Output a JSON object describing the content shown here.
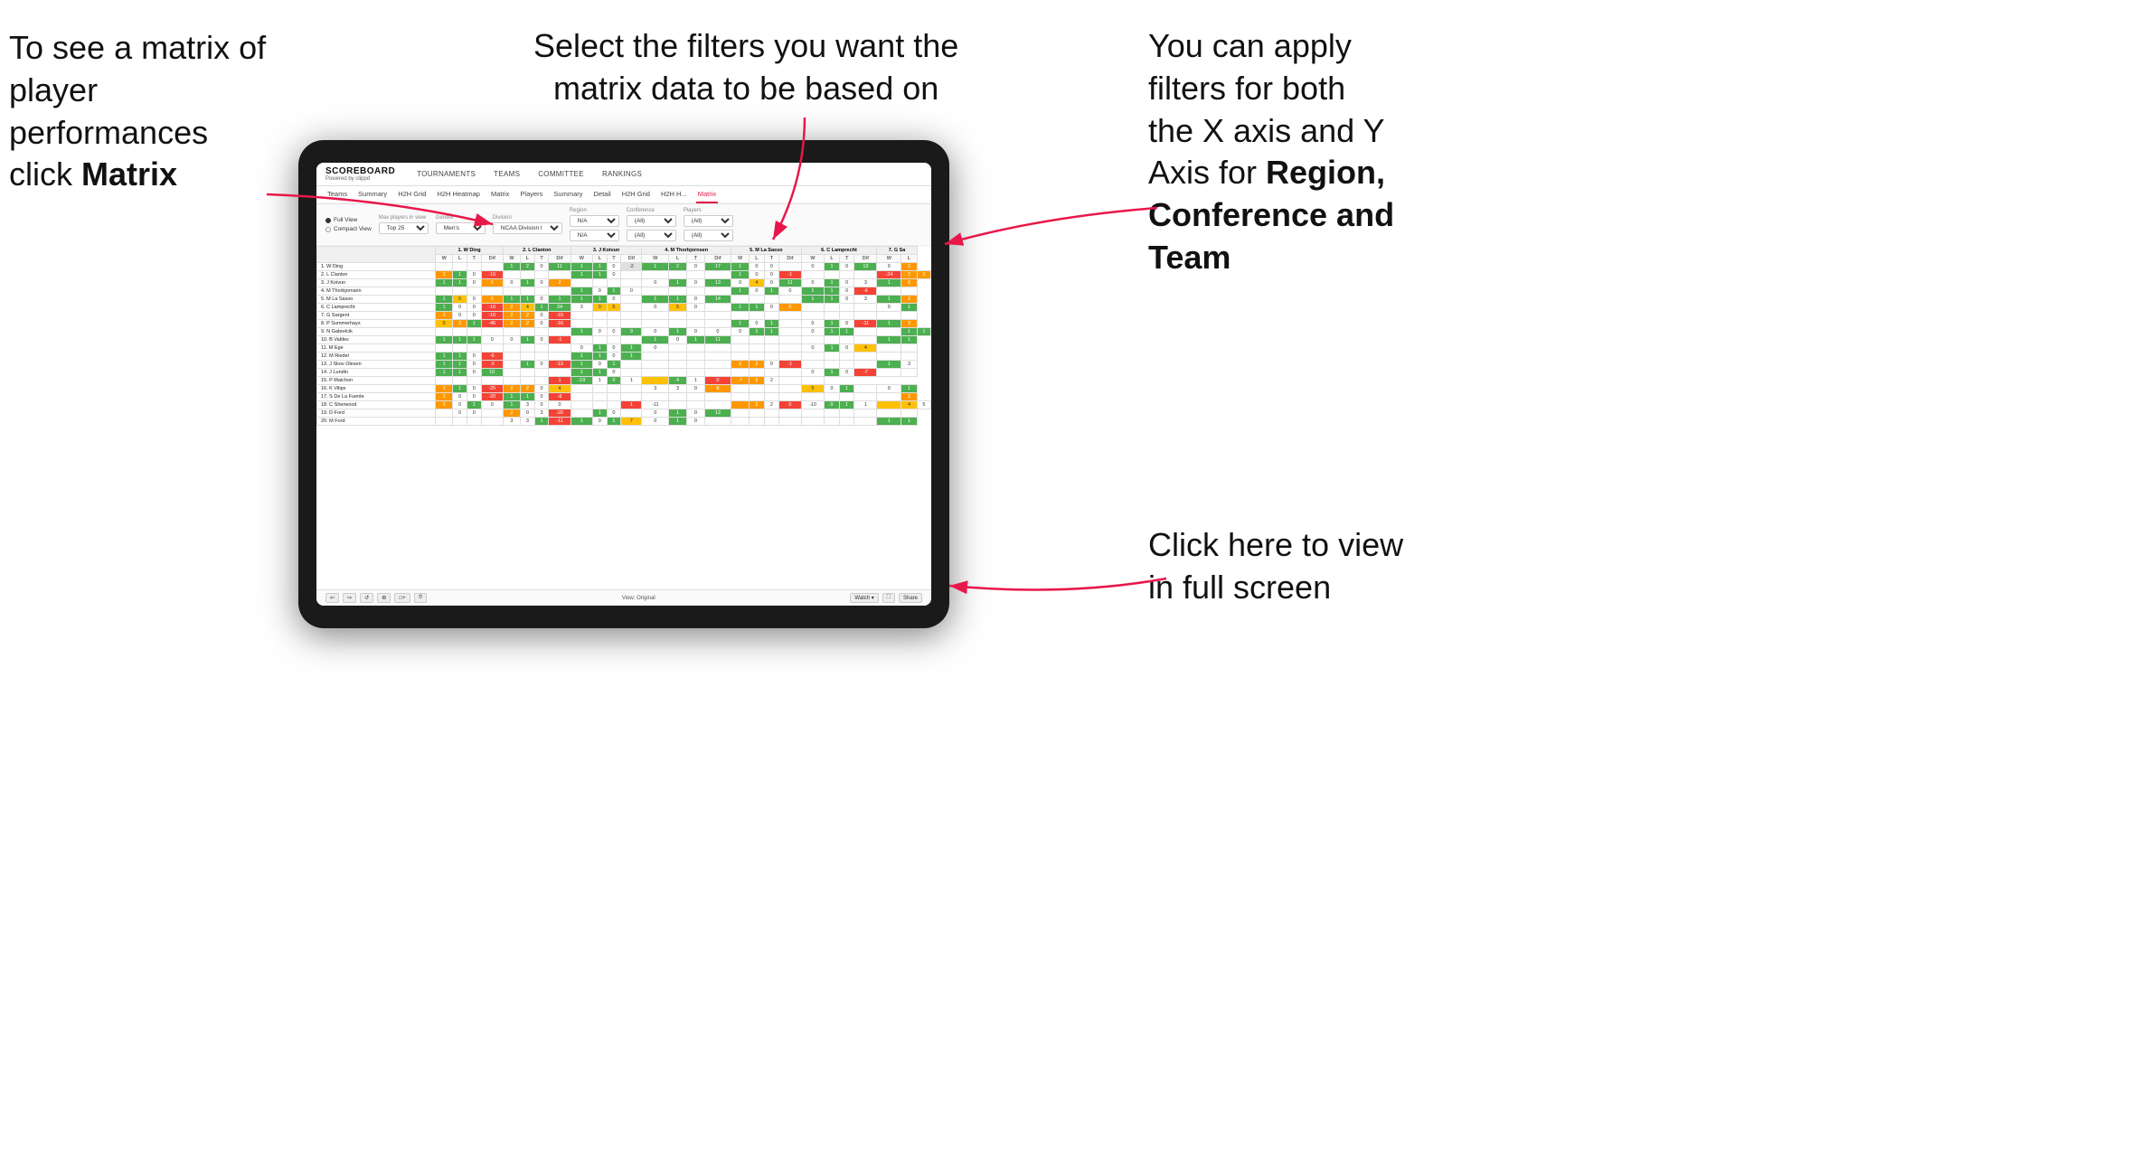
{
  "annotations": {
    "top_left": {
      "line1": "To see a matrix of",
      "line2": "player performances",
      "line3_normal": "click ",
      "line3_bold": "Matrix"
    },
    "top_center": {
      "line1": "Select the filters you want the",
      "line2": "matrix data to be based on"
    },
    "top_right": {
      "line1": "You  can apply",
      "line2": "filters for both",
      "line3": "the X axis and Y",
      "line4_normal": "Axis for ",
      "line4_bold": "Region,",
      "line5_bold": "Conference and",
      "line6_bold": "Team"
    },
    "bottom_right": {
      "line1": "Click here to view",
      "line2": "in full screen"
    }
  },
  "nav": {
    "logo_main": "SCOREBOARD",
    "logo_sub": "Powered by clippd",
    "items": [
      "TOURNAMENTS",
      "TEAMS",
      "COMMITTEE",
      "RANKINGS"
    ]
  },
  "sub_tabs": {
    "players_group": [
      "Teams",
      "Summary",
      "H2H Grid",
      "H2H Heatmap",
      "Matrix",
      "Players",
      "Summary",
      "Detail",
      "H2H Grid",
      "H2H H...",
      "Matrix"
    ],
    "active": "Matrix"
  },
  "filters": {
    "view_options": [
      "Full View",
      "Compact View"
    ],
    "active_view": "Full View",
    "max_players": {
      "label": "Max players in view",
      "value": "Top 25"
    },
    "gender": {
      "label": "Gender",
      "value": "Men's"
    },
    "division": {
      "label": "Division",
      "value": "NCAA Division I"
    },
    "region": {
      "label": "Region",
      "value1": "N/A",
      "value2": "N/A"
    },
    "conference": {
      "label": "Conference",
      "value1": "(All)",
      "value2": "(All)"
    },
    "players": {
      "label": "Players",
      "value1": "(All)",
      "value2": "(All)"
    }
  },
  "matrix": {
    "col_headers": [
      "1. W Ding",
      "2. L Clanton",
      "3. J Koivun",
      "4. M Thorbjornsen",
      "5. M La Sasso",
      "6. C Lamprecht",
      "7. G Sa"
    ],
    "sub_headers": [
      "W",
      "L",
      "T",
      "Dif"
    ],
    "rows": [
      {
        "name": "1. W Ding",
        "cells": [
          "",
          "",
          "",
          "",
          "1",
          "2",
          "0",
          "11",
          "1",
          "1",
          "0",
          "-2",
          "1",
          "2",
          "0",
          "17",
          "1",
          "0",
          "0",
          "",
          "0",
          "1",
          "0",
          "13",
          "0",
          "2"
        ]
      },
      {
        "name": "2. L Clanton",
        "cells": [
          "2",
          "1",
          "0",
          "-16",
          "",
          "",
          "",
          "",
          "1",
          "1",
          "0",
          "",
          "",
          "",
          "",
          "",
          "1",
          "0",
          "0",
          "-1",
          "",
          "",
          "",
          "",
          "-24",
          "2",
          "2"
        ]
      },
      {
        "name": "3. J Koivun",
        "cells": [
          "1",
          "1",
          "0",
          "2",
          "0",
          "1",
          "0",
          "2",
          "",
          "",
          "",
          "",
          "0",
          "1",
          "0",
          "13",
          "0",
          "4",
          "0",
          "11",
          "0",
          "1",
          "0",
          "3",
          "1",
          "2"
        ]
      },
      {
        "name": "4. M Thorbjornsen",
        "cells": [
          "",
          "",
          "",
          "",
          "",
          "",
          "",
          "",
          "1",
          "0",
          "1",
          "0",
          "",
          "",
          "",
          "",
          "1",
          "0",
          "1",
          "0",
          "1",
          "1",
          "0",
          "-6",
          "",
          ""
        ]
      },
      {
        "name": "5. M La Sasso",
        "cells": [
          "1",
          "5",
          "0",
          "6",
          "1",
          "1",
          "0",
          "1",
          "1",
          "1",
          "0",
          "",
          "1",
          "1",
          "0",
          "14",
          "",
          "",
          "",
          "",
          "1",
          "1",
          "0",
          "3",
          "1",
          "2"
        ]
      },
      {
        "name": "6. C Lamprecht",
        "cells": [
          "1",
          "0",
          "0",
          "-16",
          "2",
          "4",
          "1",
          "24",
          "3",
          "0",
          "5",
          "",
          "0",
          "5",
          "0",
          "",
          "1",
          "1",
          "0",
          "6",
          "",
          "",
          "",
          "",
          "0",
          "1"
        ]
      },
      {
        "name": "7. G Sargent",
        "cells": [
          "2",
          "0",
          "0",
          "-16",
          "2",
          "2",
          "0",
          "-15",
          "",
          "",
          "",
          "",
          "",
          "",
          "",
          "",
          "",
          "",
          "",
          "",
          "",
          "",
          "",
          "",
          "",
          ""
        ]
      },
      {
        "name": "8. P Summerhays",
        "cells": [
          "5",
          "2",
          "1",
          "-46",
          "2",
          "2",
          "0",
          "-16",
          "",
          "",
          "",
          "",
          "",
          "",
          "",
          "",
          "1",
          "0",
          "1",
          "",
          "0",
          "1",
          "0",
          "-11",
          "1",
          "2"
        ]
      },
      {
        "name": "9. N Gabrelcik",
        "cells": [
          "",
          "",
          "",
          "",
          "",
          "",
          "",
          "",
          "1",
          "0",
          "0",
          "9",
          "0",
          "1",
          "0",
          "0",
          "0",
          "1",
          "1",
          "",
          "0",
          "1",
          "1",
          "",
          "",
          "1",
          "1"
        ]
      },
      {
        "name": "10. B Valdes",
        "cells": [
          "1",
          "1",
          "1",
          "0",
          "0",
          "1",
          "0",
          "-1",
          "",
          "",
          "",
          "",
          "1",
          "0",
          "1",
          "11",
          "",
          "",
          "",
          "",
          "",
          "",
          "",
          "",
          "1",
          "1"
        ]
      },
      {
        "name": "11. M Ege",
        "cells": [
          "",
          "",
          "",
          "",
          "",
          "",
          "",
          "",
          "0",
          "1",
          "0",
          "1",
          "0",
          "",
          "",
          "",
          "",
          "",
          "",
          "",
          "0",
          "1",
          "0",
          "4",
          "",
          ""
        ]
      },
      {
        "name": "12. M Riedel",
        "cells": [
          "1",
          "1",
          "0",
          "-6",
          "",
          "",
          "",
          "",
          "1",
          "1",
          "0",
          "1",
          "",
          "",
          "",
          "",
          "",
          "",
          "",
          "",
          "",
          "",
          "",
          "",
          "",
          ""
        ]
      },
      {
        "name": "13. J Skov Olesen",
        "cells": [
          "1",
          "1",
          "0",
          "-3",
          "",
          "1",
          "0",
          "-19",
          "1",
          "0",
          "1",
          "",
          "",
          "",
          "",
          "",
          "2",
          "2",
          "0",
          "-1",
          "",
          "",
          "",
          "",
          "1",
          "3"
        ]
      },
      {
        "name": "14. J Lundin",
        "cells": [
          "1",
          "1",
          "0",
          "10",
          "",
          "",
          "",
          "",
          "1",
          "1",
          "0",
          "",
          "",
          "",
          "",
          "",
          "",
          "",
          "",
          "",
          "0",
          "1",
          "0",
          "-7",
          "",
          ""
        ]
      },
      {
        "name": "15. P Maichon",
        "cells": [
          "",
          "",
          "",
          "",
          "",
          "",
          "",
          "1",
          "-19",
          "1",
          "0",
          "1",
          "",
          "4",
          "1",
          "0",
          "-7",
          "2",
          "2",
          "",
          ""
        ]
      },
      {
        "name": "16. K Vilips",
        "cells": [
          "2",
          "1",
          "0",
          "-25",
          "2",
          "2",
          "0",
          "4",
          "",
          "",
          "",
          "",
          "3",
          "3",
          "0",
          "8",
          "",
          "",
          "",
          "",
          "5",
          "0",
          "1",
          "",
          "0",
          "1"
        ]
      },
      {
        "name": "17. S De La Fuente",
        "cells": [
          "2",
          "0",
          "0",
          "-20",
          "1",
          "1",
          "0",
          "-8",
          "",
          "",
          "",
          "",
          "",
          "",
          "",
          "",
          "",
          "",
          "",
          "",
          "",
          "",
          "",
          "",
          "",
          "2"
        ]
      },
      {
        "name": "18. C Sherwood",
        "cells": [
          "2",
          "0",
          "1",
          "0",
          "1",
          "3",
          "0",
          "0",
          "",
          "",
          "",
          "1",
          "-11",
          "",
          "",
          "",
          "",
          "2",
          "2",
          "0",
          "-10",
          "0",
          "1",
          "1",
          "",
          "4",
          "5"
        ]
      },
      {
        "name": "19. D Ford",
        "cells": [
          "",
          "0",
          "0",
          "",
          "2",
          "0",
          "3",
          "-20",
          "",
          "1",
          "0",
          "",
          "0",
          "1",
          "0",
          "13",
          "",
          "",
          "",
          "",
          "",
          "",
          "",
          "",
          "",
          ""
        ]
      },
      {
        "name": "20. M Ford",
        "cells": [
          "",
          "",
          "",
          "",
          "3",
          "3",
          "1",
          "-11",
          "1",
          "0",
          "1",
          "7",
          "0",
          "1",
          "0",
          "",
          "",
          "",
          "",
          "",
          "",
          "",
          "",
          "",
          "1",
          "1"
        ]
      }
    ]
  },
  "bottom_bar": {
    "view_label": "View: Original",
    "watch_label": "Watch ▾",
    "share_label": "Share"
  },
  "colors": {
    "arrow": "#e8174a",
    "active_tab": "#e8174a",
    "brand": "#e8174a"
  }
}
